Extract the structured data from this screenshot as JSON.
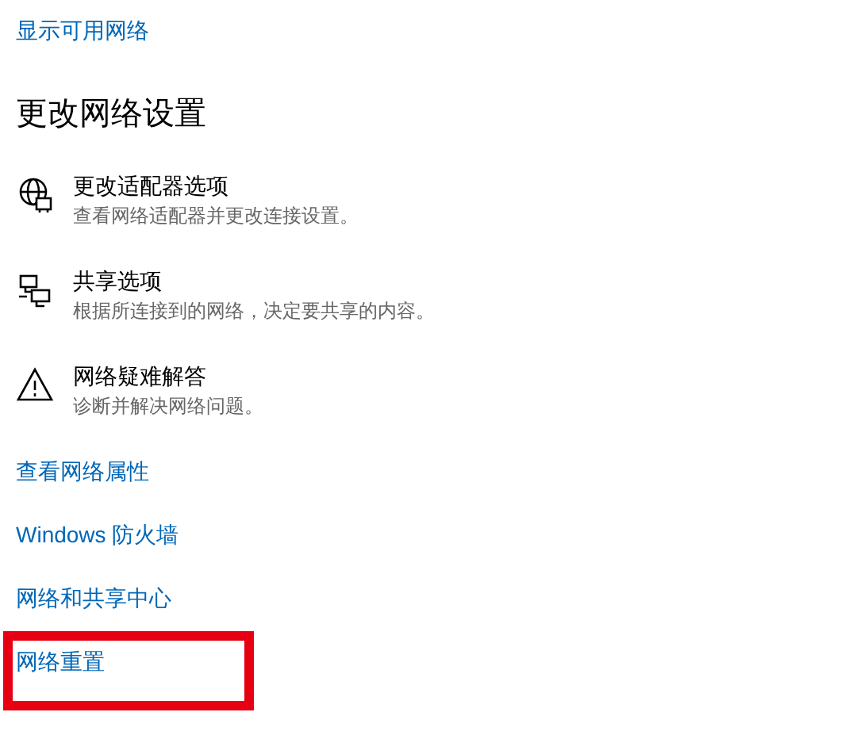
{
  "top_link": "显示可用网络",
  "heading": "更改网络设置",
  "options": [
    {
      "title": "更改适配器选项",
      "description": "查看网络适配器并更改连接设置。"
    },
    {
      "title": "共享选项",
      "description": "根据所连接到的网络，决定要共享的内容。"
    },
    {
      "title": "网络疑难解答",
      "description": "诊断并解决网络问题。"
    }
  ],
  "links": [
    {
      "label": "查看网络属性",
      "highlighted": false
    },
    {
      "label": "Windows 防火墙",
      "highlighted": false
    },
    {
      "label": "网络和共享中心",
      "highlighted": false
    },
    {
      "label": "网络重置",
      "highlighted": true
    }
  ]
}
